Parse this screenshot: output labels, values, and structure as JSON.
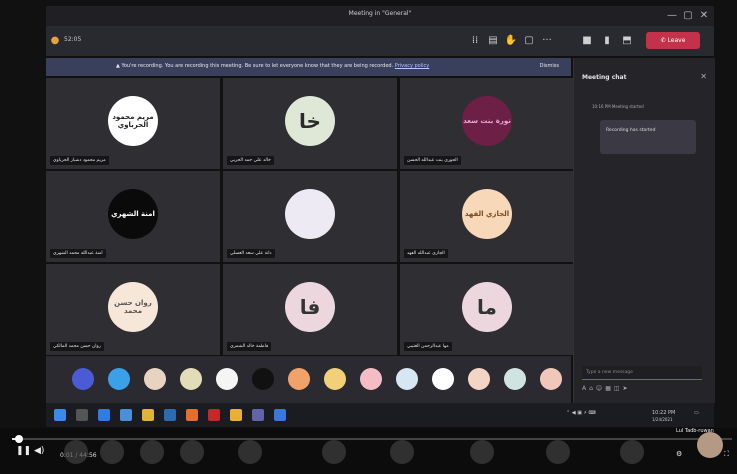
{
  "window": {
    "title": "Meeting in \"General\"",
    "controls": [
      "—",
      "▢",
      "✕"
    ]
  },
  "toolbar": {
    "timer": "52:05",
    "leave_label": "Leave"
  },
  "banner": {
    "message": "You're recording. You are recording this meeting. Be sure to let everyone know that they are being recorded.",
    "policy_link": "Privacy policy",
    "dismiss": "Dismiss"
  },
  "participants": [
    {
      "name": "مريم محمود دشبار الحرباوي",
      "avatar_text": "مريم محمود الحرباوي",
      "bg": "#ffffff",
      "fg": "#222222"
    },
    {
      "name": "خالد علي حمد الحربي",
      "avatar_text": "خا",
      "bg": "#dfe7d6",
      "fg": "#2a2a2a"
    },
    {
      "name": "الجوري بنت عبدالله الحسن",
      "avatar_text": "نورة بنت سعد",
      "bg": "#6d1f46",
      "fg": "#e6a9d7"
    },
    {
      "name": "امنة عبدالله محمد الشهري",
      "avatar_text": "امنة الشهري",
      "bg": "#0a0a0a",
      "fg": "#ffffff"
    },
    {
      "name": "دانة علي سعد العسلي",
      "avatar_text": "",
      "bg": "#eeeaf4",
      "fg": "#444444"
    },
    {
      "name": "الجازي عبدالله الفهد",
      "avatar_text": "الجازي الفهد",
      "bg": "#f7d8b8",
      "fg": "#7a4a20"
    },
    {
      "name": "روان حسن محمد المالكي",
      "avatar_text": "روان حسن محمد",
      "bg": "#f6e7d8",
      "fg": "#555555"
    },
    {
      "name": "فاطمة خالد الشمري",
      "avatar_text": "فا",
      "bg": "#ecd7de",
      "fg": "#333333"
    },
    {
      "name": "مها عبدالرحمن العتيبي",
      "avatar_text": "ما",
      "bg": "#ecd7de",
      "fg": "#333333"
    }
  ],
  "strip_colors": [
    "#4b5bd6",
    "#3aa0e8",
    "#e8d2c0",
    "#e2ddb8",
    "#f5f5f5",
    "#111111",
    "#f0a26a",
    "#f2d07a",
    "#f4bcc4",
    "#d6e6f2",
    "#ffffff",
    "#f3d5c5",
    "#cfe3e1",
    "#f0c7b9"
  ],
  "chat": {
    "header": "Meeting chat",
    "meta": "10:16 PM   Meeting started",
    "bubble": "Recording has started",
    "compose_placeholder": "Type a new message"
  },
  "taskbar": {
    "clock": "10:22 PM",
    "date": "1/24/2021"
  },
  "player": {
    "time": "0:01 / 44:56",
    "pip_label": "Lul Tadb-ruwan",
    "progress": 0.01
  }
}
